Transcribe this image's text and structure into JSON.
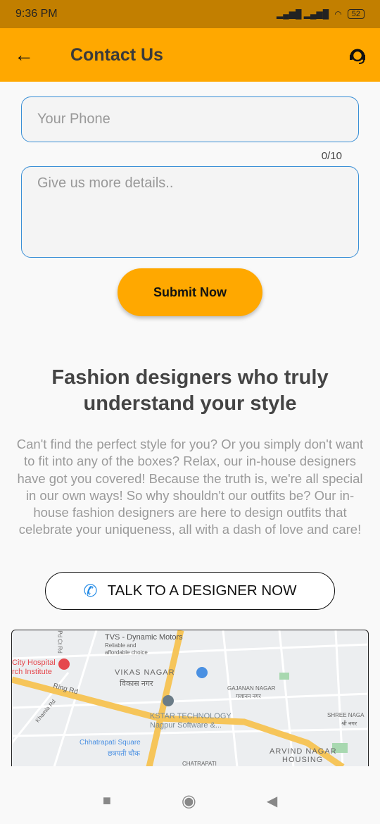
{
  "status_bar": {
    "time": "9:36 PM",
    "battery": "52"
  },
  "app_bar": {
    "title": "Contact Us"
  },
  "form": {
    "phone_placeholder": "Your Phone",
    "phone_counter": "0/10",
    "details_placeholder": "Give us more details..",
    "submit_label": "Submit Now"
  },
  "info": {
    "heading": "Fashion designers who truly understand your style",
    "body": "Can't find the perfect style for you? Or you simply don't want to fit into any of the boxes? Relax, our in-house designers have got you covered! Because the truth is, we're all special in our own ways! So why shouldn't our outfits be? Our in- house fashion designers are here to design outfits that celebrate your uniqueness, all with a dash of love and care!",
    "talk_label": "TALK TO A DESIGNER NOW"
  },
  "map": {
    "labels": [
      "TVS - Dynamic Motors",
      "Reliable and",
      "affordable choice",
      "City Hospital",
      "rch Institute",
      "VIKAS NAGAR",
      "विकास नगर",
      "Ring Rd",
      "Khamla Rd",
      "GAJANAN NAGAR",
      "गजानन नगर",
      "KSTAR TECHNOLOGY",
      "Nagpur Software &...",
      "SHREE NAGA",
      "श्री नगर",
      "Chhatrapati Square",
      "छत्रपती चौक",
      "ARVIND NAGAR",
      "HOUSING",
      "CHATRAPATI",
      "Pd Ct Rd"
    ]
  },
  "colors": {
    "accent": "#ffa800",
    "status": "#c27f00",
    "border": "#3a8fd6"
  }
}
